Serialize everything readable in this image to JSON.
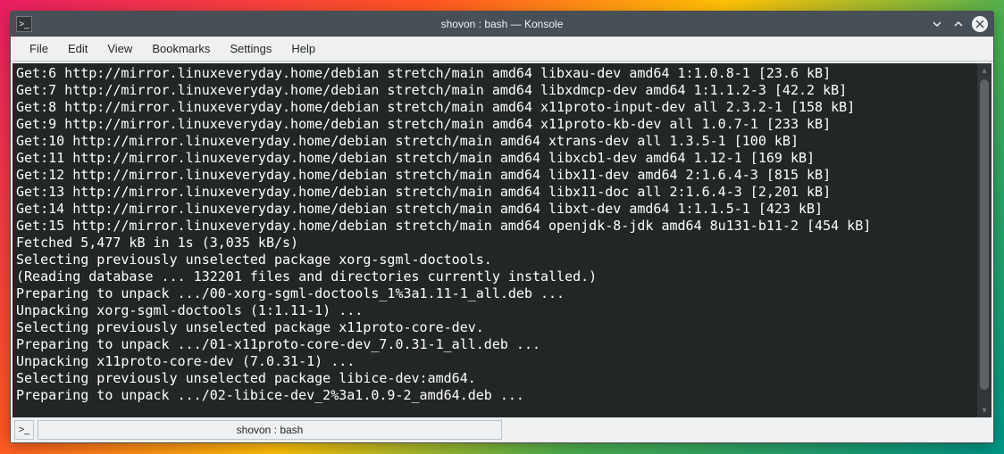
{
  "window": {
    "title": "shovon : bash — Konsole"
  },
  "menubar": {
    "items": [
      "File",
      "Edit",
      "View",
      "Bookmarks",
      "Settings",
      "Help"
    ]
  },
  "terminal": {
    "lines": [
      "Get:6 http://mirror.linuxeveryday.home/debian stretch/main amd64 libxau-dev amd64 1:1.0.8-1 [23.6 kB]",
      "Get:7 http://mirror.linuxeveryday.home/debian stretch/main amd64 libxdmcp-dev amd64 1:1.1.2-3 [42.2 kB]",
      "Get:8 http://mirror.linuxeveryday.home/debian stretch/main amd64 x11proto-input-dev all 2.3.2-1 [158 kB]",
      "Get:9 http://mirror.linuxeveryday.home/debian stretch/main amd64 x11proto-kb-dev all 1.0.7-1 [233 kB]",
      "Get:10 http://mirror.linuxeveryday.home/debian stretch/main amd64 xtrans-dev all 1.3.5-1 [100 kB]",
      "Get:11 http://mirror.linuxeveryday.home/debian stretch/main amd64 libxcb1-dev amd64 1.12-1 [169 kB]",
      "Get:12 http://mirror.linuxeveryday.home/debian stretch/main amd64 libx11-dev amd64 2:1.6.4-3 [815 kB]",
      "Get:13 http://mirror.linuxeveryday.home/debian stretch/main amd64 libx11-doc all 2:1.6.4-3 [2,201 kB]",
      "Get:14 http://mirror.linuxeveryday.home/debian stretch/main amd64 libxt-dev amd64 1:1.1.5-1 [423 kB]",
      "Get:15 http://mirror.linuxeveryday.home/debian stretch/main amd64 openjdk-8-jdk amd64 8u131-b11-2 [454 kB]",
      "Fetched 5,477 kB in 1s (3,035 kB/s)",
      "Selecting previously unselected package xorg-sgml-doctools.",
      "(Reading database ... 132201 files and directories currently installed.)",
      "Preparing to unpack .../00-xorg-sgml-doctools_1%3a1.11-1_all.deb ...",
      "Unpacking xorg-sgml-doctools (1:1.11-1) ...",
      "Selecting previously unselected package x11proto-core-dev.",
      "Preparing to unpack .../01-x11proto-core-dev_7.0.31-1_all.deb ...",
      "Unpacking x11proto-core-dev (7.0.31-1) ...",
      "Selecting previously unselected package libice-dev:amd64.",
      "Preparing to unpack .../02-libice-dev_2%3a1.0.9-2_amd64.deb ..."
    ]
  },
  "tabbar": {
    "tab_label": "shovon : bash"
  }
}
